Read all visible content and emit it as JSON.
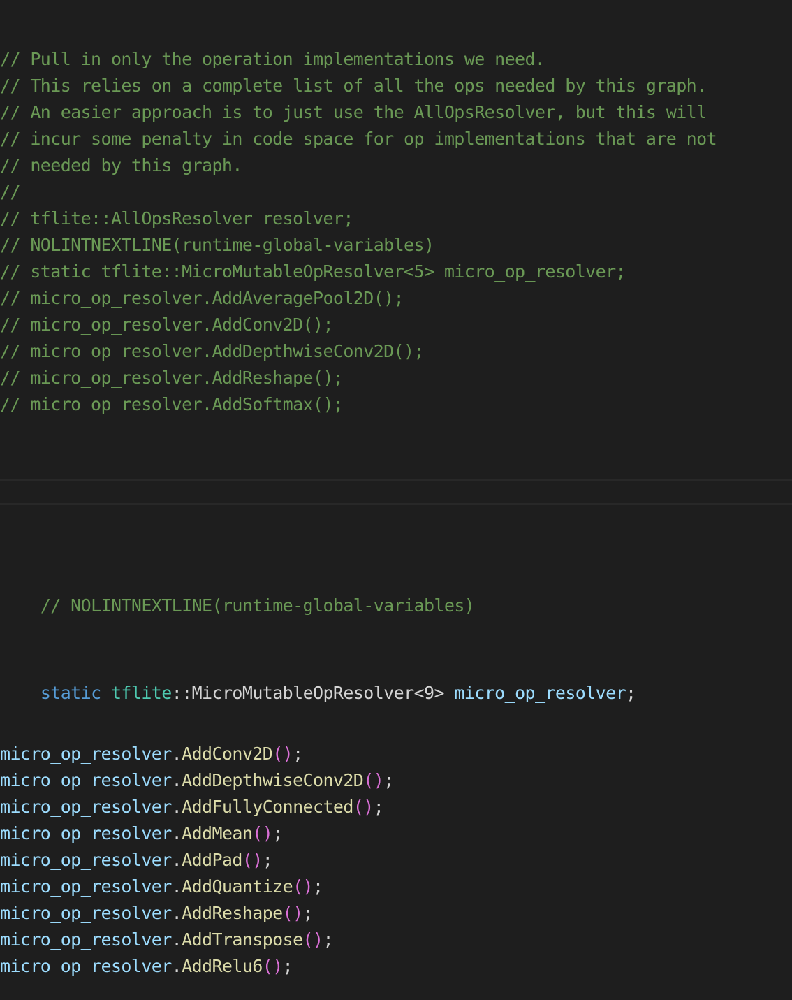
{
  "comments_block_1": [
    "// Pull in only the operation implementations we need.",
    "// This relies on a complete list of all the ops needed by this graph.",
    "// An easier approach is to just use the AllOpsResolver, but this will",
    "// incur some penalty in code space for op implementations that are not",
    "// needed by this graph.",
    "//",
    "// tflite::AllOpsResolver resolver;",
    "// NOLINTNEXTLINE(runtime-global-variables)",
    "// static tflite::MicroMutableOpResolver<5> micro_op_resolver;",
    "// micro_op_resolver.AddAveragePool2D();",
    "// micro_op_resolver.AddConv2D();",
    "// micro_op_resolver.AddDepthwiseConv2D();",
    "// micro_op_resolver.AddReshape();",
    "// micro_op_resolver.AddSoftmax();"
  ],
  "nolint_comment": "// NOLINTNEXTLINE(runtime-global-variables)",
  "static_decl": {
    "keyword": "static",
    "namespace": "tflite",
    "scope_sep": "::",
    "type_name": "MicroMutableOpResolver<9>",
    "var_name": " micro_op_resolver",
    "semicolon": ";"
  },
  "calls": {
    "object": "micro_op_resolver",
    "dot": ".",
    "open_paren": "(",
    "close_paren": ")",
    "semicolon": ";",
    "methods": [
      "AddConv2D",
      "AddDepthwiseConv2D",
      "AddFullyConnected",
      "AddMean",
      "AddPad",
      "AddQuantize",
      "AddReshape",
      "AddTranspose",
      "AddRelu6"
    ]
  },
  "colors": {
    "background": "#1e1e1e",
    "comment": "#6a9955",
    "keyword": "#569cd6",
    "namespace": "#4ec9b0",
    "identifier": "#9cdcfe",
    "function": "#dcdcaa",
    "paren": "#da70d6",
    "text": "#d4d4d4"
  }
}
